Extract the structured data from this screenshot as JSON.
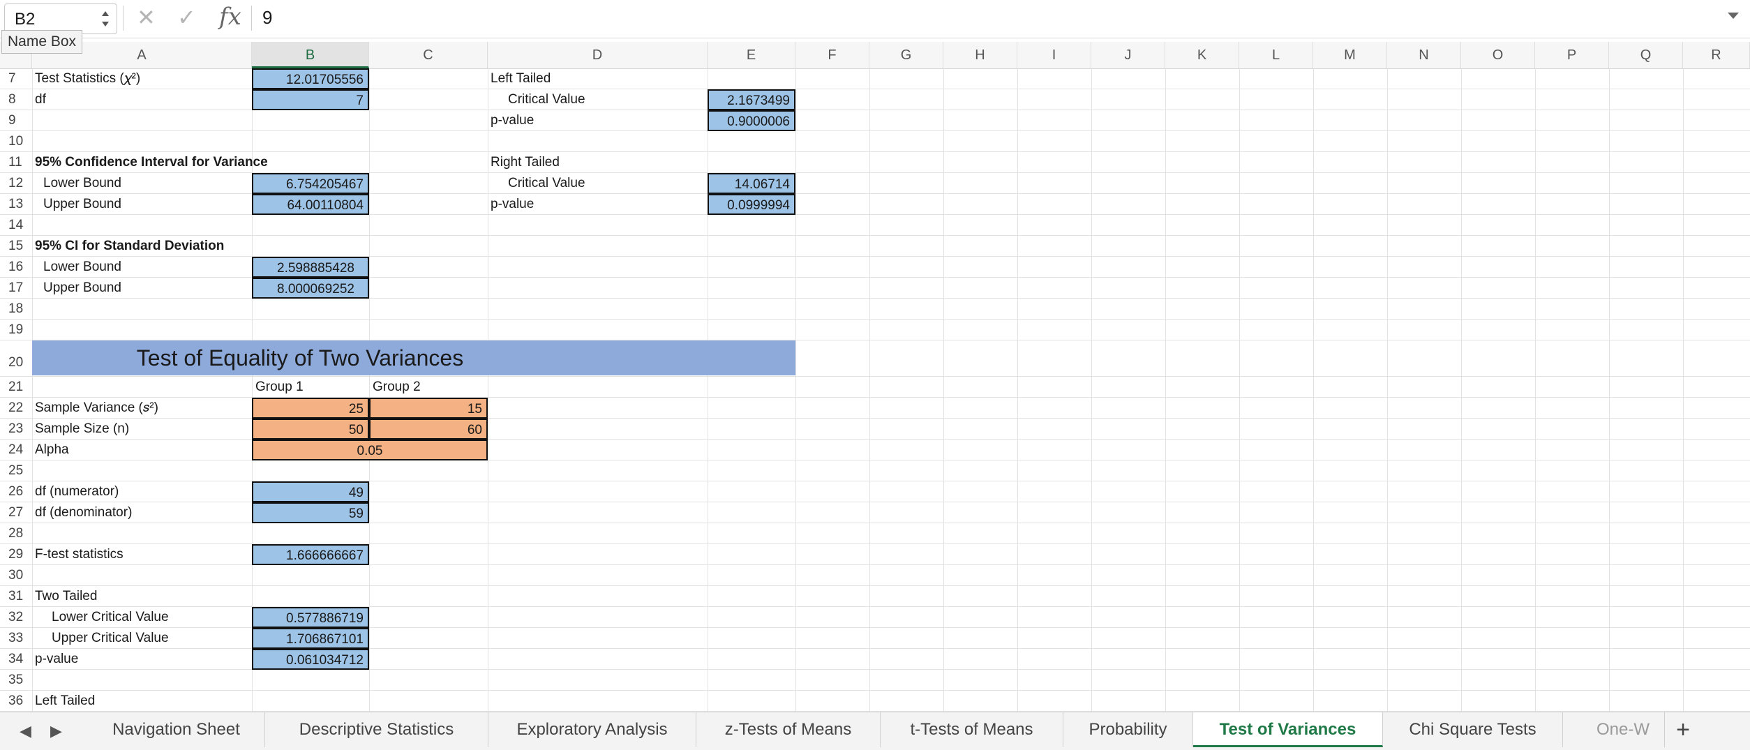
{
  "formula_bar": {
    "cell_reference": "B2",
    "formula_value": "9",
    "tooltip": "Name Box",
    "fx_label": "fx",
    "cancel_symbol": "✕",
    "enter_symbol": "✓"
  },
  "columns": [
    "A",
    "B",
    "C",
    "D",
    "E",
    "F",
    "G",
    "H",
    "I",
    "J",
    "K",
    "L",
    "M",
    "N",
    "O",
    "P",
    "Q",
    "R"
  ],
  "selected_column": "B",
  "rows": {
    "r7": {
      "num": "7",
      "a": "Test Statistics  (𝜒²)",
      "b": "12.01705556",
      "d": "Left Tailed"
    },
    "r8": {
      "num": "8",
      "a": "df",
      "b": "7",
      "d": "Critical Value",
      "e": "2.1673499"
    },
    "r9": {
      "num": "9",
      "d": "p-value",
      "e": "0.9000006"
    },
    "r10": {
      "num": "10"
    },
    "r11": {
      "num": "11",
      "a": "95% Confidence Interval for Variance",
      "d": "Right Tailed"
    },
    "r12": {
      "num": "12",
      "a": "Lower Bound",
      "b": "6.754205467",
      "d": "Critical Value",
      "e": "14.06714"
    },
    "r13": {
      "num": "13",
      "a": "Upper Bound",
      "b": "64.00110804",
      "d": "p-value",
      "e": "0.0999994"
    },
    "r14": {
      "num": "14"
    },
    "r15": {
      "num": "15",
      "a": "95% CI for Standard Deviation"
    },
    "r16": {
      "num": "16",
      "a": "Lower Bound",
      "b": "2.598885428"
    },
    "r17": {
      "num": "17",
      "a": "Upper Bound",
      "b": "8.000069252"
    },
    "r18": {
      "num": "18"
    },
    "r19": {
      "num": "19"
    },
    "r20": {
      "num": "20",
      "banner": "Test of Equality of Two Variances"
    },
    "r21": {
      "num": "21",
      "b": "Group 1",
      "c": "Group 2"
    },
    "r22": {
      "num": "22",
      "a": "Sample Variance  (𝑠²)",
      "b": "25",
      "c": "15"
    },
    "r23": {
      "num": "23",
      "a": "Sample Size (n)",
      "b": "50",
      "c": "60"
    },
    "r24": {
      "num": "24",
      "a": "Alpha",
      "b": "0.05"
    },
    "r25": {
      "num": "25"
    },
    "r26": {
      "num": "26",
      "a": "df (numerator)",
      "b": "49"
    },
    "r27": {
      "num": "27",
      "a": "df (denominator)",
      "b": "59"
    },
    "r28": {
      "num": "28"
    },
    "r29": {
      "num": "29",
      "a": "F-test statistics",
      "b": "1.666666667"
    },
    "r30": {
      "num": "30"
    },
    "r31": {
      "num": "31",
      "a": "Two Tailed"
    },
    "r32": {
      "num": "32",
      "a": "Lower Critical Value",
      "b": "0.577886719"
    },
    "r33": {
      "num": "33",
      "a": "Upper Critical Value",
      "b": "1.706867101"
    },
    "r34": {
      "num": "34",
      "a": "p-value",
      "b": "0.061034712"
    },
    "r35": {
      "num": "35"
    },
    "r36": {
      "num": "36",
      "a": "Left Tailed"
    }
  },
  "sheet_tabs": {
    "prev_symbol": "◀",
    "next_symbol": "▶",
    "items": [
      "Navigation Sheet",
      "Descriptive Statistics",
      "Exploratory Analysis",
      "z-Tests of Means",
      "t-Tests of Means",
      "Probability",
      "Test of Variances",
      "Chi Square Tests",
      "One-W"
    ],
    "active": "Test of Variances",
    "add_symbol": "+"
  },
  "colors": {
    "input_cell_fill": "#f4b183",
    "output_cell_fill": "#9dc3e6",
    "banner_fill": "#8eaadb",
    "active_accent": "#1f7a47"
  }
}
